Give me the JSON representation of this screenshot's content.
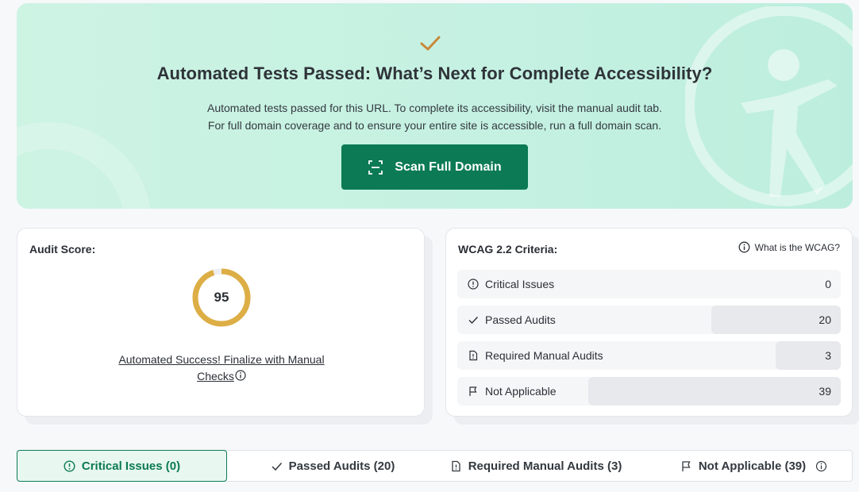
{
  "banner": {
    "title": "Automated Tests Passed: What’s Next for Complete Accessibility?",
    "line1": "Automated tests passed for this URL. To complete its accessibility, visit the manual audit tab.",
    "line2": "For full domain coverage and to ensure your entire site is accessible, run a full domain scan.",
    "scan_button": "Scan Full Domain",
    "icons": [
      "check-icon",
      "scan-icon",
      "accessibility-figure-icon"
    ]
  },
  "audit": {
    "label": "Audit Score:",
    "score": "95",
    "score_fraction": 0.95,
    "link_line1": "Automated Success! Finalize with Manual",
    "link_line2": "Checks"
  },
  "wcag": {
    "label": "WCAG 2.2 Criteria:",
    "help": "What is the WCAG?",
    "rows": [
      {
        "label": "Critical Issues",
        "value": "0",
        "icon": "alert-circle-icon"
      },
      {
        "label": "Passed Audits",
        "value": "20",
        "icon": "check-icon"
      },
      {
        "label": "Required Manual Audits",
        "value": "3",
        "icon": "document-alert-icon"
      },
      {
        "label": "Not Applicable",
        "value": "39",
        "icon": "flag-icon"
      }
    ]
  },
  "tabs": [
    {
      "label": "Critical Issues (0)",
      "icon": "alert-circle-icon",
      "active": true
    },
    {
      "label": "Passed Audits (20)",
      "icon": "check-icon"
    },
    {
      "label": "Required Manual Audits (3)",
      "icon": "document-alert-icon"
    },
    {
      "label": "Not Applicable (39)",
      "icon": "flag-icon"
    }
  ],
  "colors": {
    "brand_green": "#0b7a55",
    "gauge_gold": "#dcae45",
    "banner_bg": "#c5f1e2"
  }
}
